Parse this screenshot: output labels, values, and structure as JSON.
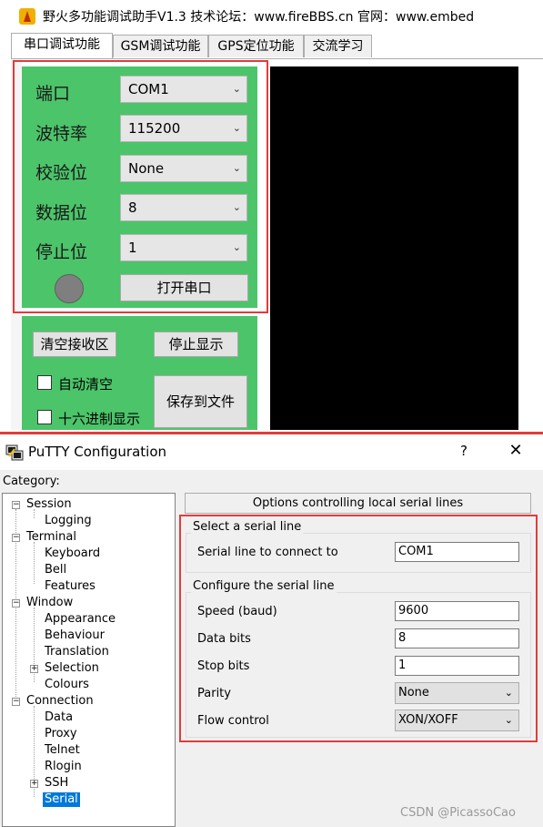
{
  "top_app": {
    "title": "野火多功能调试助手V1.3    技术论坛：www.fireBBS.cn   官网：www.embed",
    "tabs": [
      "串口调试功能",
      "GSM调试功能",
      "GPS定位功能",
      "交流学习"
    ],
    "fields": [
      {
        "label": "端口",
        "value": "COM1"
      },
      {
        "label": "波特率",
        "value": "115200"
      },
      {
        "label": "校验位",
        "value": "None"
      },
      {
        "label": "数据位",
        "value": "8"
      },
      {
        "label": "停止位",
        "value": "1"
      }
    ],
    "open_port_label": "打开串口",
    "clear_rx_label": "清空接收区",
    "stop_display_label": "停止显示",
    "auto_clear_label": "自动清空",
    "hex_display_label": "十六进制显示",
    "save_file_label": "保存到文件"
  },
  "putty": {
    "title": "PuTTY Configuration",
    "help": "?",
    "close": "✕",
    "category_label": "Category:",
    "tree": [
      {
        "label": "Session",
        "level": 0,
        "toggle": "−"
      },
      {
        "label": "Logging",
        "level": 1
      },
      {
        "label": "Terminal",
        "level": 0,
        "toggle": "−"
      },
      {
        "label": "Keyboard",
        "level": 1
      },
      {
        "label": "Bell",
        "level": 1
      },
      {
        "label": "Features",
        "level": 1
      },
      {
        "label": "Window",
        "level": 0,
        "toggle": "−"
      },
      {
        "label": "Appearance",
        "level": 1
      },
      {
        "label": "Behaviour",
        "level": 1
      },
      {
        "label": "Translation",
        "level": 1
      },
      {
        "label": "Selection",
        "level": 1,
        "toggle": "+"
      },
      {
        "label": "Colours",
        "level": 1
      },
      {
        "label": "Connection",
        "level": 0,
        "toggle": "−"
      },
      {
        "label": "Data",
        "level": 1
      },
      {
        "label": "Proxy",
        "level": 1
      },
      {
        "label": "Telnet",
        "level": 1
      },
      {
        "label": "Rlogin",
        "level": 1
      },
      {
        "label": "SSH",
        "level": 1,
        "toggle": "+"
      },
      {
        "label": "Serial",
        "level": 1,
        "selected": true
      }
    ],
    "options_header": "Options controlling local serial lines",
    "group_select_title": "Select a serial line",
    "serial_line_label": "Serial line to connect to",
    "serial_line_value": "COM1",
    "group_config_title": "Configure the serial line",
    "speed_label": "Speed (baud)",
    "speed_value": "9600",
    "data_bits_label": "Data bits",
    "data_bits_value": "8",
    "stop_bits_label": "Stop bits",
    "stop_bits_value": "1",
    "parity_label": "Parity",
    "parity_value": "None",
    "flow_control_label": "Flow control",
    "flow_control_value": "XON/XOFF"
  },
  "watermark": "CSDN @PicassoCao",
  "colors": {
    "panel_green": "#4cc46a",
    "highlight_red": "#e03c3c",
    "selection_blue": "#0078d7"
  }
}
